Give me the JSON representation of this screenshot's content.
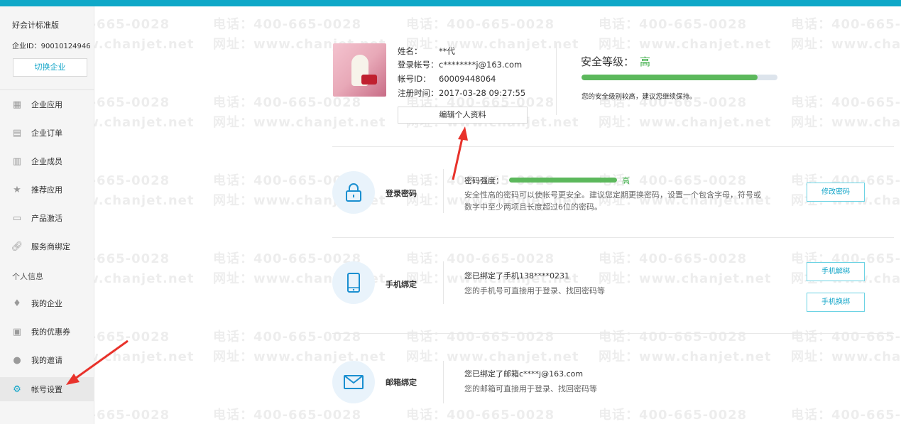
{
  "sidebar": {
    "company_name": "好会计标准版",
    "company_id": "企业ID：90010124946",
    "switch_label": "切换企业",
    "items": [
      {
        "label": "企业应用",
        "icon": "grid-icon"
      },
      {
        "label": "企业订单",
        "icon": "clipboard-icon"
      },
      {
        "label": "企业成员",
        "icon": "building-icon"
      },
      {
        "label": "推荐应用",
        "icon": "star-icon"
      },
      {
        "label": "产品激活",
        "icon": "card-icon"
      },
      {
        "label": "服务商绑定",
        "icon": "link-icon"
      }
    ],
    "section_personal": "个人信息",
    "personal_items": [
      {
        "label": "我的企业",
        "icon": "tie-icon"
      },
      {
        "label": "我的优惠券",
        "icon": "coupon-icon"
      },
      {
        "label": "我的邀请",
        "icon": "user-icon"
      },
      {
        "label": "帐号设置",
        "icon": "gear-icon",
        "active": true
      }
    ]
  },
  "watermark": {
    "phone": "电话：400-665-0028",
    "site": "网址：www.chanjet.net"
  },
  "profile": {
    "name_key": "姓名：",
    "name_val": "**代",
    "login_key": "登录帐号：",
    "login_val": "c********j@163.com",
    "id_key": "帐号ID：",
    "id_val": "60009448064",
    "reg_key": "注册时间：",
    "reg_val": "2017-03-28 09:27:55",
    "edit_label": "编辑个人资料"
  },
  "security": {
    "title": "安全等级：",
    "level": "高",
    "progress": 0.9,
    "note": "您的安全级别较高，建议您继续保持。"
  },
  "password": {
    "label": "登录密码",
    "strength_label": "密码强度：",
    "strength_level": "高",
    "desc1": "安全性高的密码可以使帐号更安全。建议您定期更换密码，设置一个包含字母，符号或",
    "desc2": "数字中至少两项且长度超过6位的密码。",
    "btn": "修改密码"
  },
  "phone": {
    "label": "手机绑定",
    "desc1": "您已绑定了手机138****0231",
    "desc2": "您的手机号可直接用于登录、找回密码等",
    "btn_unbind": "手机解绑",
    "btn_change": "手机换绑"
  },
  "email": {
    "label": "邮箱绑定",
    "desc1": "您已绑定了邮箱c****j@163.com",
    "desc2": "您的邮箱可直接用于登录、找回密码等"
  },
  "colors": {
    "accent": "#14a6c9",
    "topbar": "#0fa8c8",
    "success": "#5cb85c",
    "annotation_arrow": "#e8322b"
  }
}
